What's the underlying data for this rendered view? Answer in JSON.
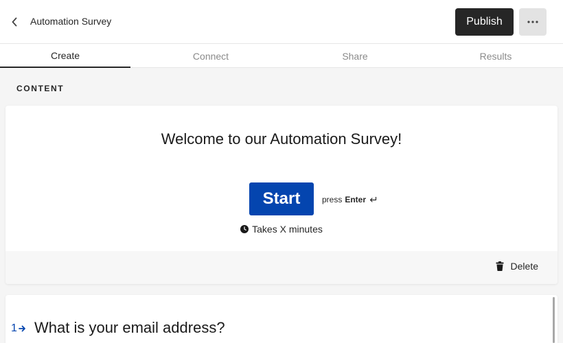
{
  "header": {
    "back_icon": "chevron-left-icon",
    "title": "Automation Survey",
    "publish_label": "Publish",
    "more_icon": "ellipsis-icon"
  },
  "tabs": [
    {
      "label": "Create",
      "active": true
    },
    {
      "label": "Connect",
      "active": false
    },
    {
      "label": "Share",
      "active": false
    },
    {
      "label": "Results",
      "active": false
    }
  ],
  "content": {
    "section_label": "CONTENT",
    "welcome": {
      "heading": "Welcome to our Automation Survey!",
      "start_label": "Start",
      "press_text": "press",
      "press_key": "Enter",
      "time_text": "Takes X minutes",
      "delete_label": "Delete"
    },
    "question": {
      "number": "1",
      "text": "What is your email address?"
    }
  },
  "colors": {
    "accent": "#0445af",
    "publish_bg": "#262626",
    "page_bg": "#f5f5f5"
  }
}
